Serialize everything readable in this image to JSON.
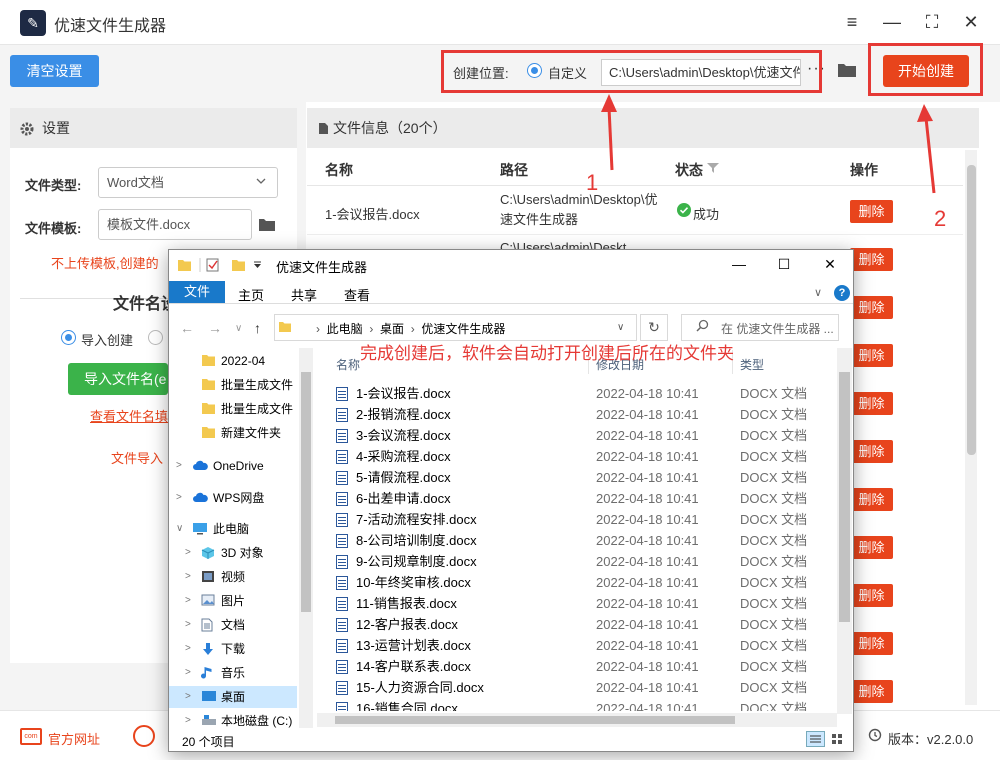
{
  "app": {
    "title": "优速文件生成器",
    "controls": [
      "≡",
      "—",
      "⛶",
      "✕"
    ]
  },
  "toolbar": {
    "clear_label": "清空设置",
    "location_label": "创建位置:",
    "custom_label": "自定义",
    "path_value": "C:\\Users\\admin\\Desktop\\优速文件生成器",
    "more": "···",
    "start_label": "开始创建"
  },
  "settings": {
    "title": "设置",
    "file_type_label": "文件类型:",
    "file_type_value": "Word文档",
    "template_label": "文件模板:",
    "template_value": "模板文件.docx",
    "warning": "不上传模板,创建的",
    "filename_title": "文件名设",
    "import_radio": "导入创建",
    "import_button": "导入文件名(e",
    "view_link": "查看文件名填",
    "import_note": "文件导入"
  },
  "info": {
    "title": "文件信息（20个）",
    "columns": [
      "名称",
      "路径",
      "状态",
      "操作"
    ],
    "rows": [
      {
        "name": "1-会议报告.docx",
        "path": "C:\\Users\\admin\\Desktop\\优速文件生成器",
        "status": "成功",
        "action": "删除"
      }
    ],
    "row2_path": "C:\\Users\\admin\\Deskt",
    "delete_label": "删除"
  },
  "footer": {
    "site_icon_text": "com",
    "site_label": "官方网址",
    "version": "版本：v2.2.0.0"
  },
  "annotations": {
    "n1": "1",
    "n2": "2",
    "note": "完成创建后，软件会自动打开创建后所在的文件夹"
  },
  "explorer": {
    "title": "优速文件生成器",
    "controls": [
      "—",
      "☐",
      "✕"
    ],
    "tabs": [
      "文件",
      "主页",
      "共享",
      "查看"
    ],
    "breadcrumb": [
      "此电脑",
      "桌面",
      "优速文件生成器"
    ],
    "search_placeholder": "在 优速文件生成器 ...",
    "headers": [
      "名称",
      "修改日期",
      "类型"
    ],
    "nav": [
      {
        "label": "2022-04",
        "icon": "folder-icon"
      },
      {
        "label": "批量生成文件",
        "icon": "folder-icon"
      },
      {
        "label": "批量生成文件",
        "icon": "folder-icon"
      },
      {
        "label": "新建文件夹",
        "icon": "folder-icon"
      },
      {
        "label": "OneDrive",
        "icon": "cloud-icon"
      },
      {
        "label": "WPS网盘",
        "icon": "cloud-icon"
      },
      {
        "label": "此电脑",
        "icon": "computer-icon"
      },
      {
        "label": "3D 对象",
        "icon": "cube-icon"
      },
      {
        "label": "视频",
        "icon": "video-icon"
      },
      {
        "label": "图片",
        "icon": "picture-icon"
      },
      {
        "label": "文档",
        "icon": "document-icon"
      },
      {
        "label": "下载",
        "icon": "download-icon"
      },
      {
        "label": "音乐",
        "icon": "music-icon"
      },
      {
        "label": "桌面",
        "icon": "desktop-icon"
      },
      {
        "label": "本地磁盘 (C:)",
        "icon": "drive-icon"
      }
    ],
    "files": [
      {
        "name": "1-会议报告.docx",
        "date": "2022-04-18 10:41",
        "type": "DOCX 文档"
      },
      {
        "name": "2-报销流程.docx",
        "date": "2022-04-18 10:41",
        "type": "DOCX 文档"
      },
      {
        "name": "3-会议流程.docx",
        "date": "2022-04-18 10:41",
        "type": "DOCX 文档"
      },
      {
        "name": "4-采购流程.docx",
        "date": "2022-04-18 10:41",
        "type": "DOCX 文档"
      },
      {
        "name": "5-请假流程.docx",
        "date": "2022-04-18 10:41",
        "type": "DOCX 文档"
      },
      {
        "name": "6-出差申请.docx",
        "date": "2022-04-18 10:41",
        "type": "DOCX 文档"
      },
      {
        "name": "7-活动流程安排.docx",
        "date": "2022-04-18 10:41",
        "type": "DOCX 文档"
      },
      {
        "name": "8-公司培训制度.docx",
        "date": "2022-04-18 10:41",
        "type": "DOCX 文档"
      },
      {
        "name": "9-公司规章制度.docx",
        "date": "2022-04-18 10:41",
        "type": "DOCX 文档"
      },
      {
        "name": "10-年终奖审核.docx",
        "date": "2022-04-18 10:41",
        "type": "DOCX 文档"
      },
      {
        "name": "11-销售报表.docx",
        "date": "2022-04-18 10:41",
        "type": "DOCX 文档"
      },
      {
        "name": "12-客户报表.docx",
        "date": "2022-04-18 10:41",
        "type": "DOCX 文档"
      },
      {
        "name": "13-运营计划表.docx",
        "date": "2022-04-18 10:41",
        "type": "DOCX 文档"
      },
      {
        "name": "14-客户联系表.docx",
        "date": "2022-04-18 10:41",
        "type": "DOCX 文档"
      },
      {
        "name": "15-人力资源合同.docx",
        "date": "2022-04-18 10:41",
        "type": "DOCX 文档"
      },
      {
        "name": "16-销售合同.docx",
        "date": "2022-04-18 10:41",
        "type": "DOCX 文档"
      }
    ],
    "status_count": "20 个项目"
  },
  "colors": {
    "accent_blue": "#3a8ee6",
    "accent_red": "#e8441c",
    "green": "#3bb34a",
    "annotation_red": "#e53935",
    "explorer_blue": "#1979ca"
  }
}
